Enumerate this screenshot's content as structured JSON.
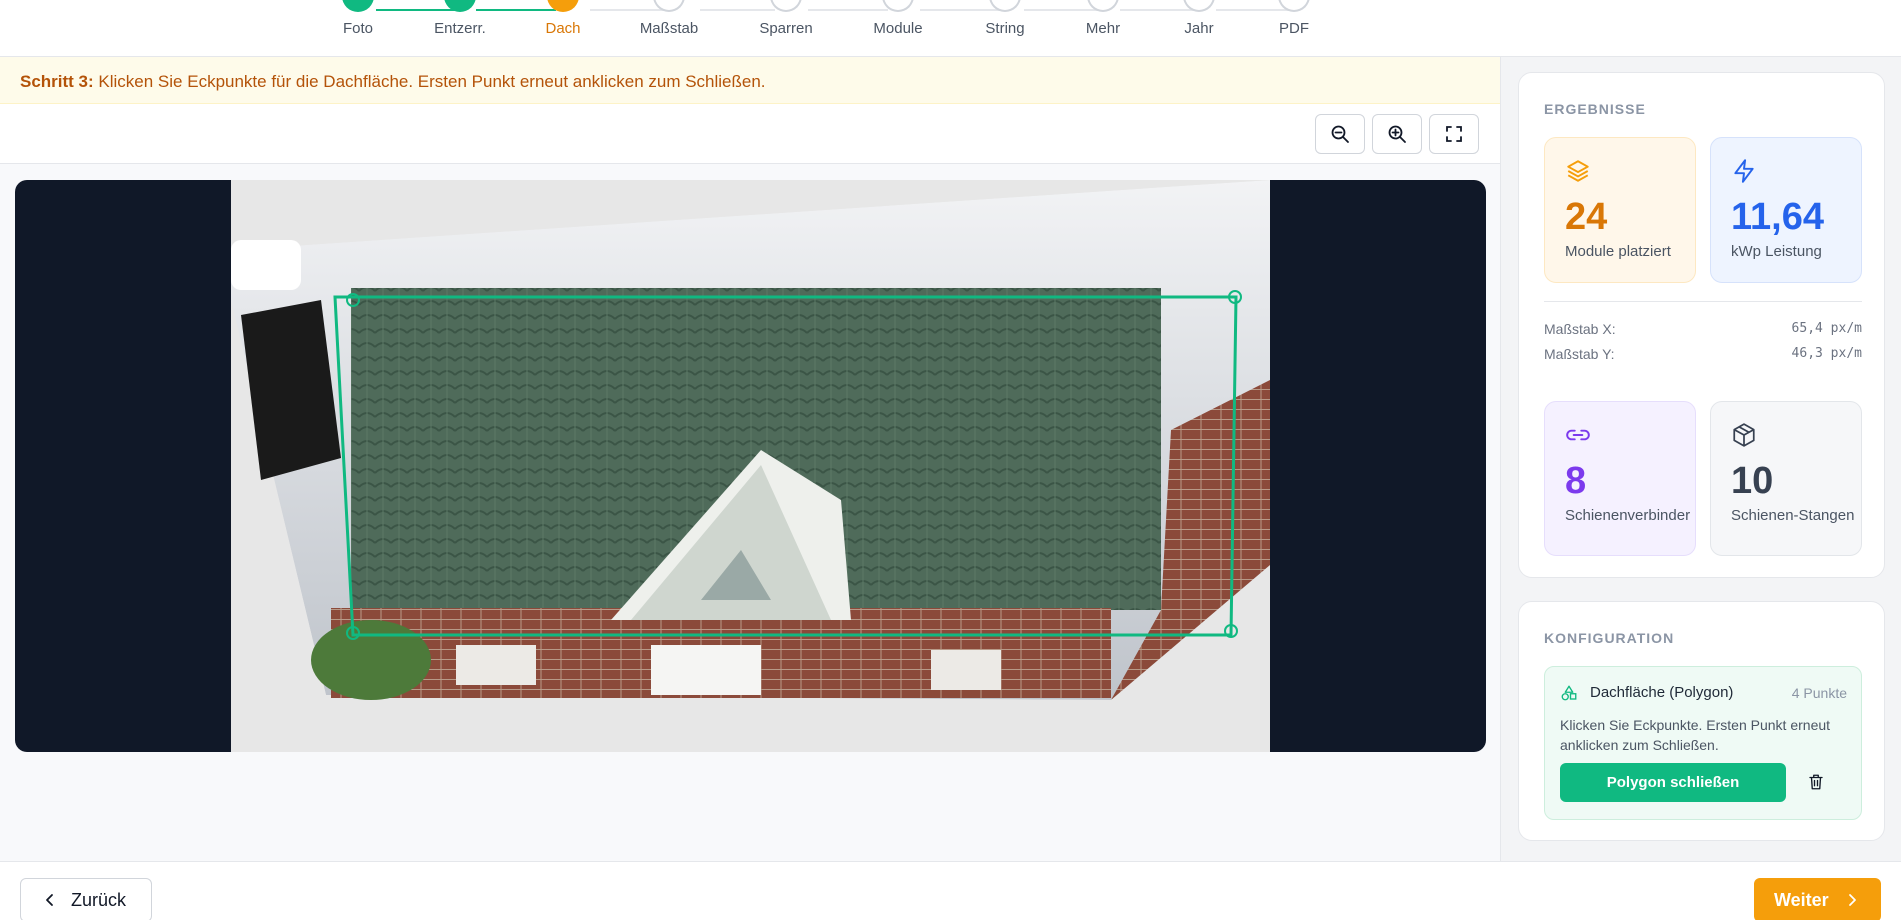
{
  "stepper": {
    "steps": [
      {
        "label": "Foto",
        "state": "done",
        "number": ""
      },
      {
        "label": "Entzerr.",
        "state": "done",
        "number": ""
      },
      {
        "label": "Dach",
        "state": "active",
        "number": ""
      },
      {
        "label": "Maßstab",
        "state": "pending",
        "number": ""
      },
      {
        "label": "Sparren",
        "state": "pending",
        "number": ""
      },
      {
        "label": "Module",
        "state": "pending",
        "number": ""
      },
      {
        "label": "String",
        "state": "pending",
        "number": ""
      },
      {
        "label": "Mehr",
        "state": "pending",
        "number": ""
      },
      {
        "label": "Jahr",
        "state": "pending",
        "number": ""
      },
      {
        "label": "PDF",
        "state": "pending",
        "number": ""
      }
    ]
  },
  "banner": {
    "step_label": "Schritt 3:",
    "text": " Klicken Sie Eckpunkte für die Dachfläche. Ersten Punkt erneut anklicken zum Schließen."
  },
  "toolbar": {
    "zoom_out_icon": "zoom-out-icon",
    "zoom_in_icon": "zoom-in-icon",
    "fullscreen_icon": "fullscreen-icon"
  },
  "results": {
    "title": "ERGEBNISSE",
    "modules": {
      "value": "24",
      "label": "Module platziert",
      "icon": "layers-icon",
      "color": "#d97706"
    },
    "power": {
      "value": "11,64",
      "label": "kWp Leistung",
      "icon": "lightning-icon",
      "color": "#2563eb"
    },
    "scale_x": {
      "label": "Maßstab X:",
      "value": "65,4 px/m"
    },
    "scale_y": {
      "label": "Maßstab Y:",
      "value": "46,3 px/m"
    },
    "connectors": {
      "value": "8",
      "label": "Schienenverbinder",
      "icon": "link-icon",
      "color": "#7c3aed"
    },
    "rails": {
      "value": "10",
      "label": "Schienen-Stangen",
      "icon": "box-icon",
      "color": "#374151"
    }
  },
  "config": {
    "title": "KONFIGURATION",
    "polygon_title": "Dachfläche (Polygon)",
    "points": "4 Punkte",
    "hint": "Klicken Sie Eckpunkte. Ersten Punkt erneut anklicken zum Schließen.",
    "close_button": "Polygon schließen",
    "delete_icon": "trash-icon"
  },
  "footer": {
    "back": "Zurück",
    "next": "Weiter"
  }
}
